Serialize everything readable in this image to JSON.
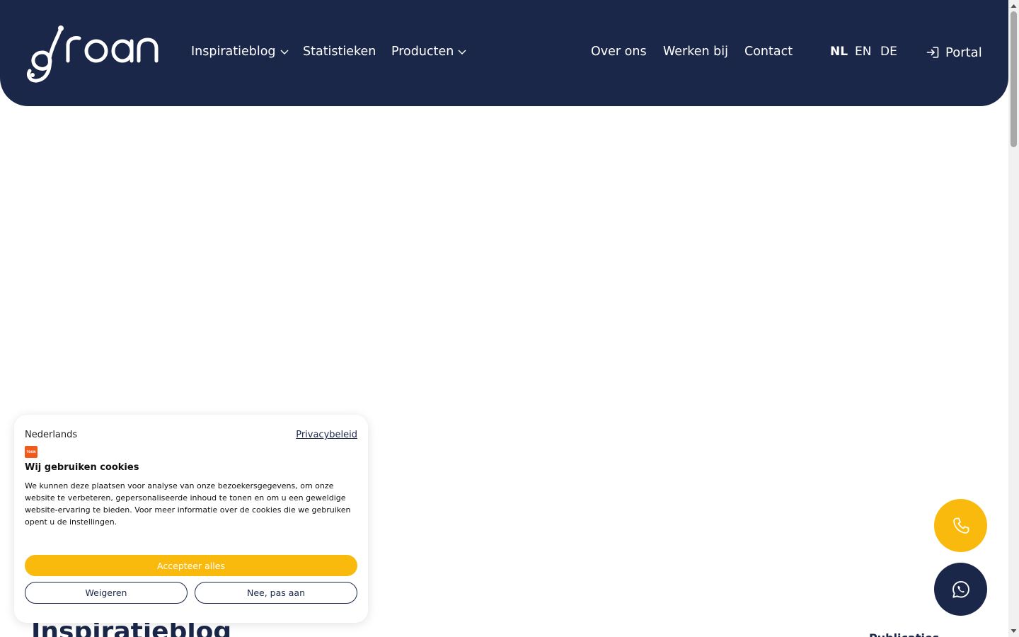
{
  "brand": {
    "logo_text": "groan",
    "primary": "#1b2749",
    "accent": "#f9b90d"
  },
  "nav": {
    "left": [
      {
        "label": "Inspiratieblog",
        "has_dropdown": true
      },
      {
        "label": "Statistieken",
        "has_dropdown": false
      },
      {
        "label": "Producten",
        "has_dropdown": true
      }
    ],
    "right": [
      {
        "label": "Over ons"
      },
      {
        "label": "Werken bij"
      },
      {
        "label": "Contact"
      }
    ],
    "languages": [
      {
        "code": "NL",
        "active": true
      },
      {
        "code": "EN",
        "active": false
      },
      {
        "code": "DE",
        "active": false
      }
    ],
    "portal": {
      "label": "Portal",
      "icon": "login-icon"
    }
  },
  "cookie": {
    "language": "Nederlands",
    "privacy_link": "Privacybeleid",
    "title": "Wij gebruiken cookies",
    "text": "We kunnen deze plaatsen voor analyse van onze bezoekersgegevens, om onze website te verbeteren, gepersonaliseerde inhoud te tonen en om u een geweldige website-ervaring te bieden. Voor meer informatie over de cookies die we gebruiken opent u de instellingen.",
    "accept_label": "Accepteer alles",
    "decline_label": "Weigeren",
    "customize_label": "Nee, pas aan"
  },
  "page": {
    "heading": "Inspiratieblog",
    "right_label": "Publicaties"
  },
  "floating": {
    "phone_icon": "phone-icon",
    "whatsapp_icon": "whatsapp-icon"
  }
}
